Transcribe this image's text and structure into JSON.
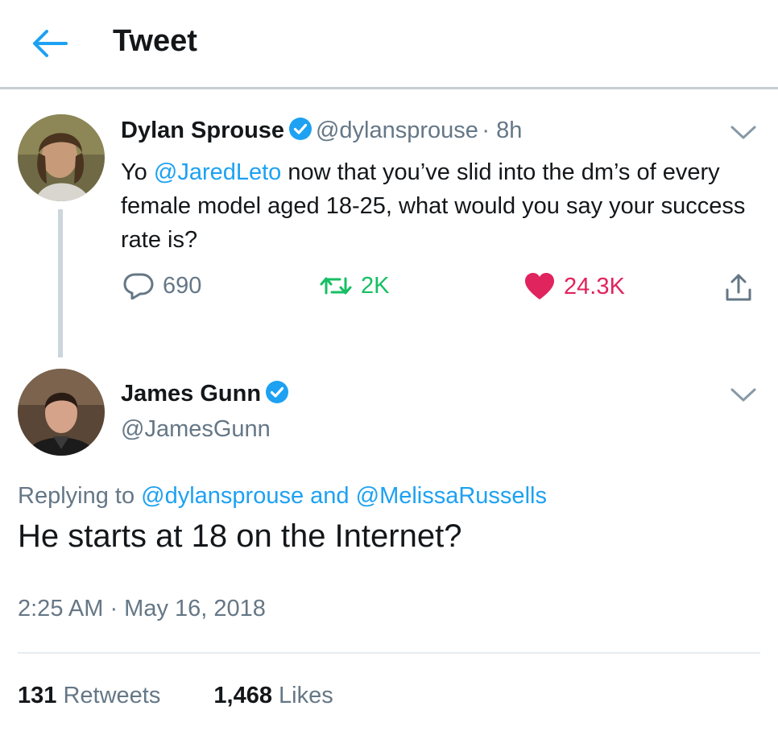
{
  "header": {
    "title": "Tweet",
    "back_icon": "arrow-left-icon",
    "accent": "#1da1f2"
  },
  "parent_tweet": {
    "name": "Dylan Sprouse",
    "handle": "@dylansprouse",
    "time": "· 8h",
    "text_prefix": "Yo ",
    "mention": "@JaredLeto",
    "text_suffix": " now that you’ve slid into the dm’s of every female model aged 18-25, what would you say your success rate is?",
    "replies": "690",
    "retweets": "2K",
    "likes": "24.3K",
    "liked": true,
    "colors": {
      "retweet": "#17bf63",
      "like": "#e0245e"
    }
  },
  "main_tweet": {
    "name": "James Gunn",
    "handle": "@JamesGunn",
    "replying_label": "Replying to",
    "replying_user1": "@dylansprouse",
    "replying_and": "and",
    "replying_user2": "@MelissaRussells",
    "text": "He starts at 18 on the Internet?",
    "timestamp": "2:25 AM · May 16, 2018",
    "retweet_count": "131",
    "retweet_label": "Retweets",
    "like_count": "1,468",
    "like_label": "Likes"
  }
}
